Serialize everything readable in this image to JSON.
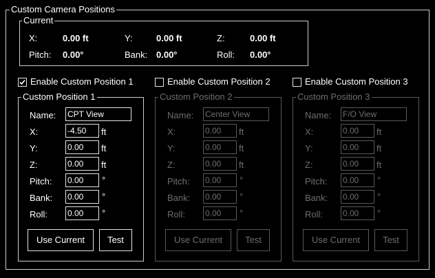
{
  "group": {
    "title": "Custom Camera Positions"
  },
  "current": {
    "title": "Current",
    "x_label": "X:",
    "x_value": "0.00 ft",
    "y_label": "Y:",
    "y_value": "0.00 ft",
    "z_label": "Z:",
    "z_value": "0.00 ft",
    "pitch_label": "Pitch:",
    "pitch_value": "0.00°",
    "bank_label": "Bank:",
    "bank_value": "0.00°",
    "roll_label": "Roll:",
    "roll_value": "0.00°"
  },
  "labels": {
    "name": "Name:",
    "x": "X:",
    "y": "Y:",
    "z": "Z:",
    "pitch": "Pitch:",
    "bank": "Bank:",
    "roll": "Roll:",
    "unit_ft": "ft",
    "unit_deg": "°",
    "use_current": "Use Current",
    "test": "Test"
  },
  "positions": [
    {
      "enable_label": "Enable Custom Position 1",
      "enabled": true,
      "title": "Custom Position 1",
      "name": "CPT View",
      "x": "-4.50",
      "y": "0.00",
      "z": "0.00",
      "pitch": "0.00",
      "bank": "0.00",
      "roll": "0.00"
    },
    {
      "enable_label": "Enable Custom Position 2",
      "enabled": false,
      "title": "Custom Position 2",
      "name": "Center View",
      "x": "0.00",
      "y": "0.00",
      "z": "0.00",
      "pitch": "0.00",
      "bank": "0.00",
      "roll": "0.00"
    },
    {
      "enable_label": "Enable Custom Position 3",
      "enabled": false,
      "title": "Custom Position 3",
      "name": "F/O View",
      "x": "0.00",
      "y": "0.00",
      "z": "0.00",
      "pitch": "0.00",
      "bank": "0.00",
      "roll": "0.00"
    }
  ]
}
